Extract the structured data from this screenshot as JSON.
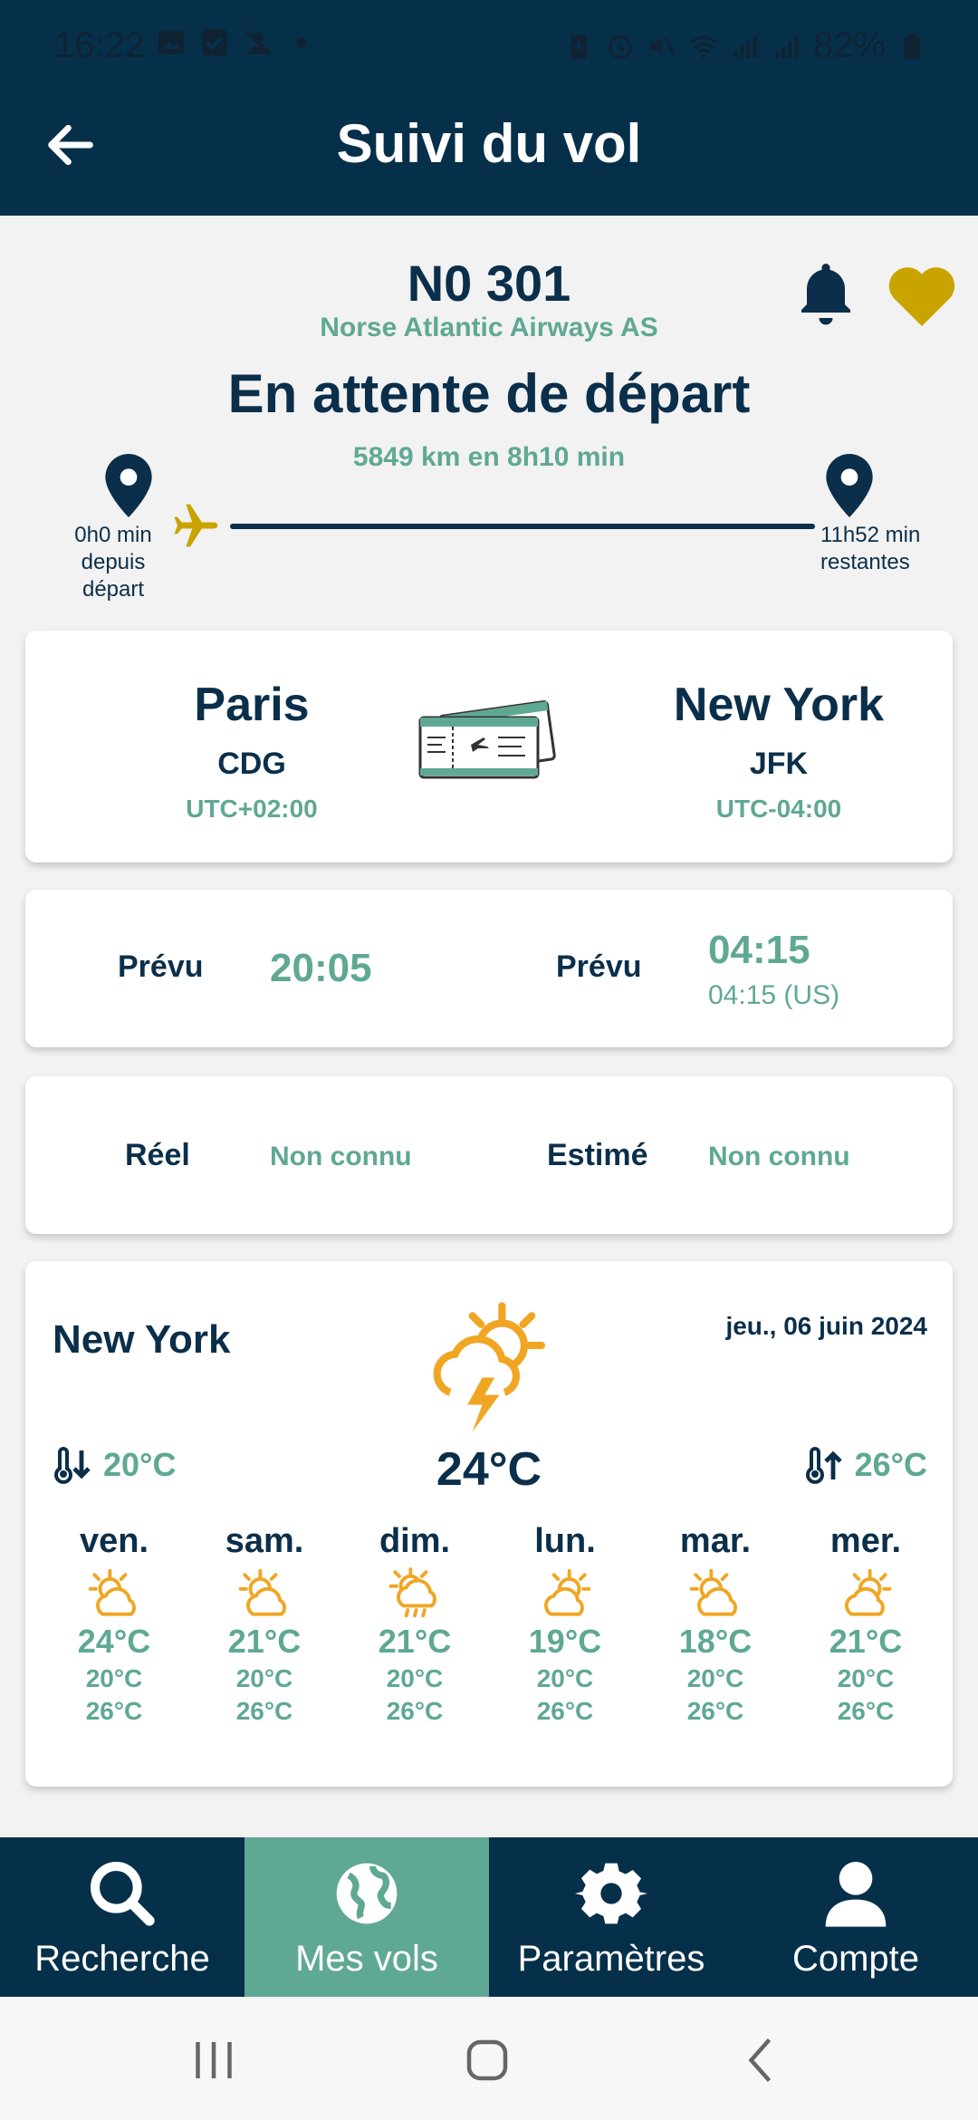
{
  "status_bar": {
    "time": "16:22",
    "battery": "82%",
    "left_icons": [
      "gallery-icon",
      "check-square-icon",
      "person-off-icon",
      "dot-icon"
    ],
    "right_icons": [
      "battery-saver-icon",
      "alarm-icon",
      "mute-icon",
      "wifi-icon",
      "signal-icon",
      "signal-icon"
    ]
  },
  "app_bar": {
    "title": "Suivi du vol",
    "back_icon": "arrow-left-icon"
  },
  "flight": {
    "number": "N0 301",
    "airline": "Norse Atlantic Airways AS",
    "status": "En attente de départ",
    "distance": "5849 km en 8h10 min",
    "elapsed_lines": [
      "0h0 min",
      "depuis",
      "départ"
    ],
    "remaining_lines": [
      "11h52 min",
      "restantes"
    ],
    "progress_fraction": 0.0,
    "colors": {
      "accent": "#5fa894",
      "navy": "#0b2f4a",
      "gold": "#c9a400"
    }
  },
  "route": {
    "origin": {
      "city": "Paris",
      "code": "CDG",
      "tz": "UTC+02:00"
    },
    "destination": {
      "city": "New York",
      "code": "JFK",
      "tz": "UTC-04:00"
    }
  },
  "schedule": {
    "dep_label": "Prévu",
    "dep_time": "20:05",
    "arr_label": "Prévu",
    "arr_time": "04:15",
    "arr_local": "04:15 (US)"
  },
  "actual": {
    "dep_label": "Réel",
    "dep_value": "Non connu",
    "arr_label": "Estimé",
    "arr_value": "Non connu"
  },
  "weather": {
    "city": "New York",
    "date": "jeu., 06 juin 2024",
    "current_temp": "24°C",
    "min_temp": "20°C",
    "max_temp": "26°C",
    "current_icon": "sun-cloud-lightning-icon",
    "forecast": [
      {
        "day": "ven.",
        "icon": "partly-sunny-icon",
        "temp": "24°C",
        "lo": "20°C",
        "hi": "26°C"
      },
      {
        "day": "sam.",
        "icon": "partly-sunny-icon",
        "temp": "21°C",
        "lo": "20°C",
        "hi": "26°C"
      },
      {
        "day": "dim.",
        "icon": "sun-cloud-rain-icon",
        "temp": "21°C",
        "lo": "20°C",
        "hi": "26°C"
      },
      {
        "day": "lun.",
        "icon": "partly-sunny-icon",
        "temp": "19°C",
        "lo": "20°C",
        "hi": "26°C"
      },
      {
        "day": "mar.",
        "icon": "partly-sunny-icon",
        "temp": "18°C",
        "lo": "20°C",
        "hi": "26°C"
      },
      {
        "day": "mer.",
        "icon": "partly-sunny-icon",
        "temp": "21°C",
        "lo": "20°C",
        "hi": "26°C"
      }
    ]
  },
  "bottom_nav": [
    {
      "label": "Recherche",
      "icon": "search-icon",
      "active": false
    },
    {
      "label": "Mes vols",
      "icon": "globe-icon",
      "active": true
    },
    {
      "label": "Paramètres",
      "icon": "gear-icon",
      "active": false
    },
    {
      "label": "Compte",
      "icon": "user-icon",
      "active": false
    }
  ]
}
